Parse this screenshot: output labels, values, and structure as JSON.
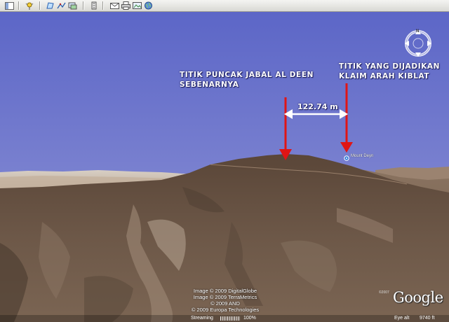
{
  "toolbar": {
    "buttons": [
      {
        "name": "hide-sidebar-button",
        "icon": "sidebar-icon"
      },
      {
        "name": "add-placemark-button",
        "icon": "placemark-icon"
      },
      {
        "name": "add-polygon-button",
        "icon": "polygon-icon"
      },
      {
        "name": "add-path-button",
        "icon": "path-icon"
      },
      {
        "name": "add-overlay-button",
        "icon": "overlay-icon"
      },
      {
        "name": "record-tour-button",
        "icon": "record-icon"
      },
      {
        "name": "email-button",
        "icon": "email-icon"
      },
      {
        "name": "print-button",
        "icon": "print-icon"
      },
      {
        "name": "save-image-button",
        "icon": "save-image-icon"
      },
      {
        "name": "view-in-maps-button",
        "icon": "maps-icon"
      }
    ]
  },
  "annotations": {
    "actual_peak": [
      "TITIK PUNCAK JABAL AL DEEN",
      "SEBENARNYA"
    ],
    "claimed_point": [
      "TITIK YANG DIJADIKAN",
      "KLAIM ARAH KIBLAT"
    ],
    "distance": "122.74 m"
  },
  "placemark": {
    "label": "Mount Deyn",
    "icon": "placemark-pin-icon"
  },
  "compass": {
    "north_letter": "N"
  },
  "credits": [
    "Image © 2009 DigitalGlobe",
    "Image © 2009 TerraMetrics",
    "© 2009 AND",
    "© 2009 Europa Technologies"
  ],
  "logo": {
    "text": "Google",
    "year": "©2007"
  },
  "status": {
    "streaming_label": "Streaming",
    "streaming_percent": "100%",
    "eye_alt_label": "Eye alt",
    "eye_alt_value": "9740 ft"
  },
  "colors": {
    "sky_top": "#5d67c8",
    "sky_bottom": "#a7acd8",
    "arrow": "#e01515",
    "terrain": "#6b5747"
  }
}
